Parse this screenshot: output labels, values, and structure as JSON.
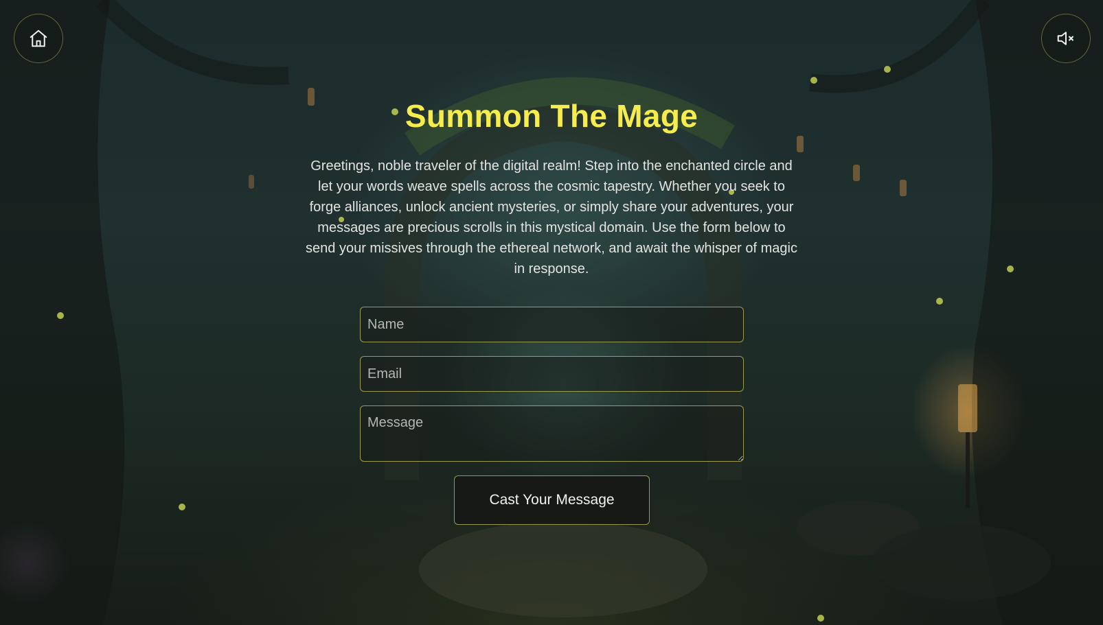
{
  "nav": {
    "home_icon": "home-icon",
    "sound_icon": "volume-muted-icon"
  },
  "contact": {
    "title": "Summon The Mage",
    "intro": "Greetings, noble traveler of the digital realm! Step into the enchanted circle and let your words weave spells across the cosmic tapestry. Whether you seek to forge alliances, unlock ancient mysteries, or simply share your adventures, your messages are precious scrolls in this mystical domain. Use the form below to send your missives through the ethereal network, and await the whisper of magic in response.",
    "fields": {
      "name_placeholder": "Name",
      "email_placeholder": "Email",
      "message_placeholder": "Message"
    },
    "submit_label": "Cast Your Message"
  },
  "colors": {
    "title": "#f7ec4e",
    "border_accent": "#c8c35f",
    "background": "#1d2a28"
  }
}
